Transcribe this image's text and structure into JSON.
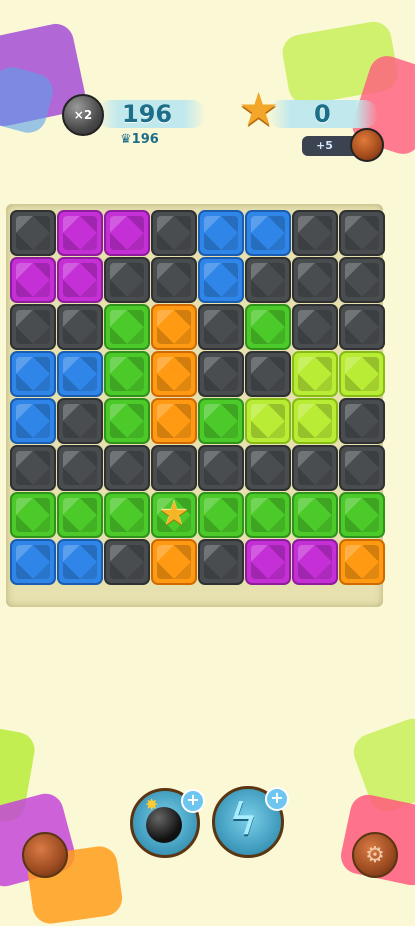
{
  "hud": {
    "multiplier": "×2",
    "score": "196",
    "best_score": "196",
    "stars": "0",
    "bonus": "+5"
  },
  "board": {
    "colors": {
      "gray": "#4a4d50",
      "purple": "#c52fd6",
      "blue": "#2f86e8",
      "green": "#4cca2a",
      "orange": "#ff9a12",
      "lime": "#b9ec34"
    },
    "rows": [
      [
        "gray",
        "purple",
        "purple",
        "gray",
        "blue",
        "blue",
        "gray",
        "gray"
      ],
      [
        "purple",
        "purple",
        "gray",
        "gray",
        "blue",
        "gray",
        "gray",
        "gray"
      ],
      [
        "gray",
        "gray",
        "green",
        "orange",
        "gray",
        "green",
        "gray",
        "gray"
      ],
      [
        "blue",
        "blue",
        "green",
        "orange",
        "gray",
        "gray",
        "lime",
        "lime"
      ],
      [
        "blue",
        "gray",
        "green",
        "orange",
        "green",
        "lime",
        "lime",
        "gray"
      ],
      [
        "gray",
        "gray",
        "gray",
        "gray",
        "gray",
        "gray",
        "gray",
        "gray"
      ],
      [
        "green",
        "green",
        "green",
        "star",
        "green",
        "green",
        "green",
        "green"
      ],
      [
        "blue",
        "blue",
        "gray",
        "orange",
        "gray",
        "purple",
        "purple",
        "orange"
      ]
    ]
  },
  "boosters": [
    {
      "name": "bomb",
      "icon": "bomb-icon"
    },
    {
      "name": "lightning",
      "icon": "lightning-icon"
    }
  ]
}
